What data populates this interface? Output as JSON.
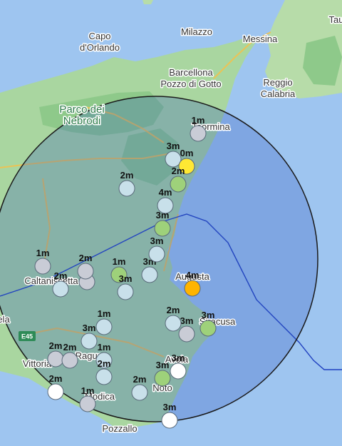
{
  "map": {
    "places": [
      {
        "id": "capo-dorlando",
        "lines": [
          "Capo",
          "d'Orlando"
        ],
        "style": "dark"
      },
      {
        "id": "milazzo",
        "lines": [
          "Milazzo"
        ],
        "style": "dark"
      },
      {
        "id": "messina",
        "lines": [
          "Messina"
        ],
        "style": "dark"
      },
      {
        "id": "barcellona",
        "lines": [
          "Barcellona",
          "Pozzo di Gotto"
        ],
        "style": "dark"
      },
      {
        "id": "reggio",
        "lines": [
          "Reggio",
          "Calabria"
        ],
        "style": "dark"
      },
      {
        "id": "parco",
        "lines": [
          "Parco dei",
          "Nebrodi"
        ],
        "style": "green"
      },
      {
        "id": "taormina",
        "lines": [
          "Taormina"
        ],
        "style": "dark"
      },
      {
        "id": "augusta",
        "lines": [
          "Augusta"
        ],
        "style": "dark"
      },
      {
        "id": "siracusa",
        "lines": [
          "Siracusa"
        ],
        "style": "dark"
      },
      {
        "id": "caltanissetta",
        "lines": [
          "Caltanissetta"
        ],
        "style": "dark"
      },
      {
        "id": "gela",
        "lines": [
          "ela"
        ],
        "style": "dark"
      },
      {
        "id": "vittoria",
        "lines": [
          "Vittoria"
        ],
        "style": "dark"
      },
      {
        "id": "ragusa",
        "lines": [
          "Ragusa"
        ],
        "style": "dark"
      },
      {
        "id": "modica",
        "lines": [
          "Modica"
        ],
        "style": "dark"
      },
      {
        "id": "noto",
        "lines": [
          "Noto"
        ],
        "style": "dark"
      },
      {
        "id": "avola",
        "lines": [
          "Avola"
        ],
        "style": "dark"
      },
      {
        "id": "pozzallo",
        "lines": [
          "Pozzallo"
        ],
        "style": "dark"
      },
      {
        "id": "tau",
        "lines": [
          "Tau"
        ],
        "style": "dark"
      }
    ],
    "road_shield": "E45",
    "markers": [
      {
        "label": "1m",
        "color": "#c9ccd6"
      },
      {
        "label": "3m",
        "color": "#c8e0ea"
      },
      {
        "label": "0m",
        "color": "#ffe833"
      },
      {
        "label": "2m",
        "color": "#c8e0ea"
      },
      {
        "label": "2m",
        "color": "#9ed17a"
      },
      {
        "label": "4m",
        "color": "#c8e0ea"
      },
      {
        "label": "3m",
        "color": "#9ed17a"
      },
      {
        "label": "1m",
        "color": "#c9ccd6"
      },
      {
        "label": "2m",
        "color": "#c8e0ea"
      },
      {
        "label": "3m",
        "color": "#c9ccd6"
      },
      {
        "label": "2m",
        "color": "#c9ccd6"
      },
      {
        "label": "1m",
        "color": "#9ed17a"
      },
      {
        "label": "3m",
        "color": "#c8e0ea"
      },
      {
        "label": "4m",
        "color": "#ffb400"
      },
      {
        "label": "1m",
        "color": "#c8e0ea"
      },
      {
        "label": "3m",
        "color": "#c9ccd6"
      },
      {
        "label": "2m",
        "color": "#c8e0ea"
      },
      {
        "label": "3m",
        "color": "#9ed17a"
      },
      {
        "label": "2m",
        "color": "#c9ccd6"
      },
      {
        "label": "3m",
        "color": "#c8e0ea"
      },
      {
        "label": "1m",
        "color": "#c8e0ea"
      },
      {
        "label": "2m",
        "color": "#c8e0ea"
      },
      {
        "label": "2m",
        "color": "#ffffff"
      },
      {
        "label": "1m",
        "color": "#c9ccd6"
      },
      {
        "label": "2m",
        "color": "#c8e0ea"
      },
      {
        "label": "3m",
        "color": "#9ed17a"
      },
      {
        "label": "3m",
        "color": "#ffffff"
      },
      {
        "label": "3m",
        "color": "#ffffff"
      },
      {
        "label": "2m",
        "color": "#c9ccd6"
      },
      {
        "label": "3m",
        "color": "#c8e0ea"
      },
      {
        "label": "3m",
        "color": "#c8e0ea"
      }
    ]
  }
}
